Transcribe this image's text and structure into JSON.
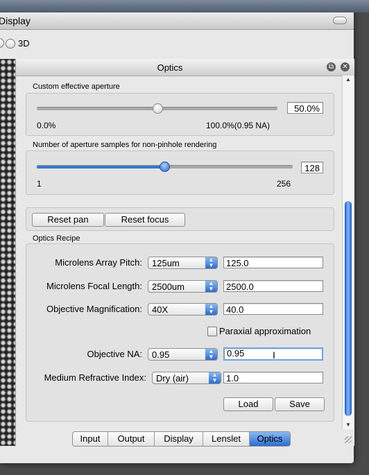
{
  "window": {
    "title": "Display"
  },
  "toolbar": {
    "radio_3d_label": "3D"
  },
  "panel": {
    "title": "Optics",
    "aperture": {
      "group_title": "Custom effective aperture",
      "min_label": "0.0%",
      "max_label": "100.0%(0.95 NA)",
      "value_field": "50.0%",
      "slider_value_fraction": 0.5
    },
    "samples": {
      "group_title": "Number of aperture samples for non-pinhole rendering",
      "min_label": "1",
      "max_label": "256",
      "value_field": "128",
      "slider_value": 128
    },
    "buttons": {
      "reset_pan": "Reset pan",
      "reset_focus": "Reset focus"
    },
    "recipe": {
      "group_title": "Optics Recipe",
      "pitch_label": "Microlens Array Pitch:",
      "pitch_combo": "125um",
      "pitch_value": "125.0",
      "focal_label": "Microlens Focal Length:",
      "focal_combo": "2500um",
      "focal_value": "2500.0",
      "mag_label": "Objective Magnification:",
      "mag_combo": "40X",
      "mag_value": "40.0",
      "paraxial_label": "Paraxial approximation",
      "paraxial_checked": false,
      "na_label": "Objective NA:",
      "na_combo": "0.95",
      "na_value": "0.95",
      "medium_label": "Medium Refractive Index:",
      "medium_combo": "Dry (air)",
      "medium_value": "1.0",
      "load": "Load",
      "save": "Save"
    },
    "tabs": [
      "Input",
      "Output",
      "Display",
      "Lenslet",
      "Optics"
    ],
    "active_tab": "Optics"
  },
  "icons": {
    "detach": "detach-icon",
    "close": "close-icon",
    "combo_arrow": "updown-arrows-icon",
    "cursor": "text-cursor-icon"
  }
}
